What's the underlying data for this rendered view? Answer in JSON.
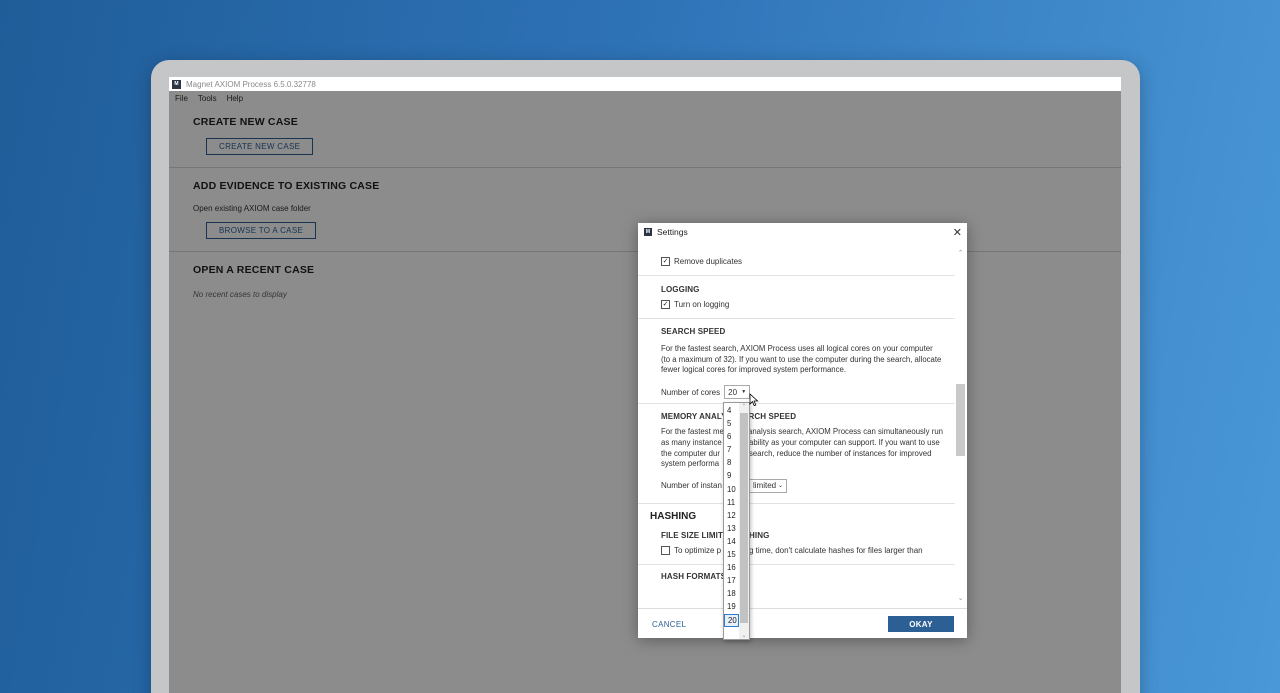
{
  "app": {
    "window_title": "Magnet AXIOM Process 6.5.0.32778",
    "menu": [
      "File",
      "Tools",
      "Help"
    ]
  },
  "main": {
    "create_section_title": "CREATE NEW CASE",
    "create_button": "CREATE NEW CASE",
    "add_section_title": "ADD EVIDENCE TO EXISTING CASE",
    "add_subtext": "Open existing AXIOM case folder",
    "browse_button": "BROWSE TO A CASE",
    "recent_section_title": "OPEN A RECENT CASE",
    "recent_empty": "No recent cases to display"
  },
  "dialog": {
    "title": "Settings",
    "close_glyph": "✕",
    "remove_duplicates_label": "Remove duplicates",
    "remove_duplicates_checked": true,
    "logging_title": "LOGGING",
    "logging_label": "Turn on logging",
    "logging_checked": true,
    "search_speed_title": "SEARCH SPEED",
    "search_speed_desc": "For the fastest search, AXIOM Process uses all logical cores on your computer (to a maximum of 32). If you want to use the computer during the search, allocate fewer logical cores for improved system performance.",
    "cores_label": "Number of cores",
    "cores_value": "20",
    "memory_title_left": "MEMORY ANALY",
    "memory_title_right": "RCH SPEED",
    "memory_lines": [
      {
        "left": "For the fastest me",
        "right": "analysis search, AXIOM Process can simultaneously run"
      },
      {
        "left": "as many instance",
        "right": "ability as your computer can support.  If you want to use"
      },
      {
        "left": "the computer dur",
        "right": "search, reduce the number of instances for improved"
      },
      {
        "left": "system performa",
        "right": ""
      }
    ],
    "instances_label": "Number of instan",
    "instances_value": "limited",
    "hashing_title": "HASHING",
    "file_size_title_left": "FILE SIZE LIMIT FO",
    "file_size_title_right": "HING",
    "file_size_label_left": "To optimize p",
    "file_size_label_right": "g time, don't calculate hashes for files larger than",
    "file_size_checked": false,
    "hash_formats_title": "HASH FORMATS",
    "cancel_label": "CANCEL",
    "okay_label": "OKAY"
  },
  "dropdown": {
    "options": [
      "4",
      "5",
      "6",
      "7",
      "8",
      "9",
      "10",
      "11",
      "12",
      "13",
      "14",
      "15",
      "16",
      "17",
      "18",
      "19",
      "20"
    ],
    "selected": "20"
  },
  "colors": {
    "accent": "#2c5f93",
    "background_gradient_start": "#1f5d99",
    "background_gradient_end": "#4a98d8"
  }
}
